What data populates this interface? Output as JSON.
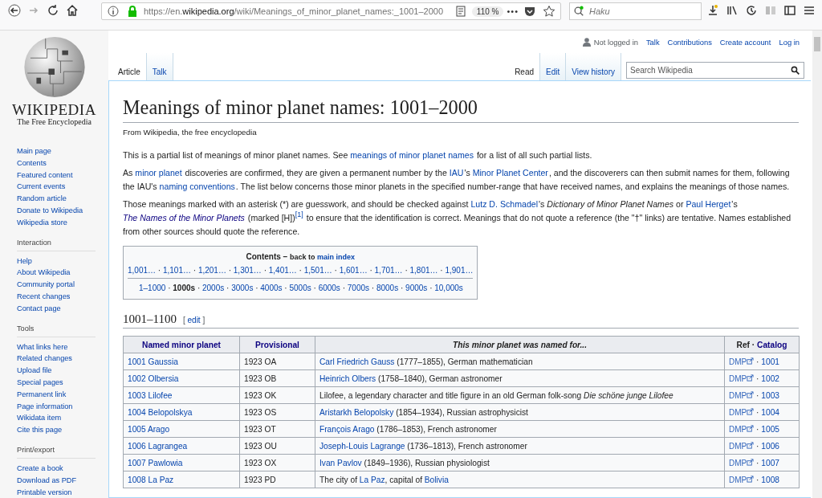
{
  "browser": {
    "forward_disabled": true,
    "url": {
      "scheme": "https://en.",
      "domain": "wikipedia.org",
      "path": "/wiki/Meanings_of_minor_planet_names:_1001–2000"
    },
    "zoom": "110 %",
    "more": "•••",
    "search": {
      "placeholder": "Haku"
    }
  },
  "logo": {
    "wordmark": "WIKIPEDIA",
    "tagline": "The Free Encyclopedia"
  },
  "sidebar": [
    {
      "items": [
        "Main page",
        "Contents",
        "Featured content",
        "Current events",
        "Random article",
        "Donate to Wikipedia",
        "Wikipedia store"
      ]
    },
    {
      "heading": "Interaction",
      "items": [
        "Help",
        "About Wikipedia",
        "Community portal",
        "Recent changes",
        "Contact page"
      ]
    },
    {
      "heading": "Tools",
      "items": [
        "What links here",
        "Related changes",
        "Upload file",
        "Special pages",
        "Permanent link",
        "Page information",
        "Wikidata item",
        "Cite this page"
      ]
    },
    {
      "heading": "Print/export",
      "items": [
        "Create a book",
        "Download as PDF",
        "Printable version"
      ]
    }
  ],
  "personal": {
    "status": "Not logged in",
    "links": [
      "Talk",
      "Contributions",
      "Create account",
      "Log in"
    ]
  },
  "tabs_left": [
    {
      "label": "Article",
      "selected": true
    },
    {
      "label": "Talk",
      "selected": false
    }
  ],
  "tabs_right": [
    {
      "label": "Read",
      "selected": true
    },
    {
      "label": "Edit",
      "selected": false
    },
    {
      "label": "View history",
      "selected": false
    }
  ],
  "wiki_search": {
    "placeholder": "Search Wikipedia"
  },
  "title": "Meanings of minor planet names: 1001–2000",
  "tagline": "From Wikipedia, the free encyclopedia",
  "paragraphs": [
    [
      {
        "kind": "text",
        "text": "This is a partial list of meanings of minor planet names. See "
      },
      {
        "kind": "link",
        "text": "meanings of minor planet names"
      },
      {
        "kind": "text",
        "text": " for a list of all such partial lists."
      }
    ],
    [
      {
        "kind": "text",
        "text": "As "
      },
      {
        "kind": "link",
        "text": "minor planet"
      },
      {
        "kind": "text",
        "text": " discoveries are confirmed, they are given a permanent number by the "
      },
      {
        "kind": "link",
        "text": "IAU"
      },
      {
        "kind": "text",
        "text": "'s "
      },
      {
        "kind": "link",
        "text": "Minor Planet Center"
      },
      {
        "kind": "text",
        "text": ", and the discoverers can then submit names for them, following the IAU's "
      },
      {
        "kind": "link",
        "text": "naming conventions"
      },
      {
        "kind": "text",
        "text": ". The list below concerns those minor planets in the specified number-range that have received names, and explains the meanings of those names."
      }
    ],
    [
      {
        "kind": "text",
        "text": "Those meanings marked with an asterisk (*) are guesswork, and should be checked against "
      },
      {
        "kind": "link",
        "text": "Lutz D. Schmadel"
      },
      {
        "kind": "text",
        "text": "'s "
      },
      {
        "kind": "italic",
        "text": "Dictionary of Minor Planet Names"
      },
      {
        "kind": "text",
        "text": " or "
      },
      {
        "kind": "link",
        "text": "Paul Herget"
      },
      {
        "kind": "text",
        "text": "'s "
      },
      {
        "kind": "italic-link",
        "text": "The Names of the Minor Planets"
      },
      {
        "kind": "text",
        "text": " (marked [H])"
      },
      {
        "kind": "sup-link",
        "text": "[1]"
      },
      {
        "kind": "text",
        "text": " to ensure that the identification is correct. Meanings that do not quote a reference (the \"†\" links) are tentative. Names established from other sources should quote the reference."
      }
    ]
  ],
  "contents": {
    "title": "Contents",
    "dash": "–",
    "back": [
      {
        "kind": "text",
        "text": "back to "
      },
      {
        "kind": "link",
        "text": "main index"
      }
    ],
    "row1": [
      {
        "label": "1,001…",
        "selected": false
      },
      {
        "label": "1,101…",
        "selected": false
      },
      {
        "label": "1,201…",
        "selected": false
      },
      {
        "label": "1,301…",
        "selected": false
      },
      {
        "label": "1,401…",
        "selected": false
      },
      {
        "label": "1,501…",
        "selected": false
      },
      {
        "label": "1,601…",
        "selected": false
      },
      {
        "label": "1,701…",
        "selected": false
      },
      {
        "label": "1,801…",
        "selected": false
      },
      {
        "label": "1,901…",
        "selected": false
      }
    ],
    "row2": [
      {
        "label": "1–1000",
        "selected": false
      },
      {
        "label": "1000s",
        "selected": true
      },
      {
        "label": "2000s",
        "selected": false
      },
      {
        "label": "3000s",
        "selected": false
      },
      {
        "label": "4000s",
        "selected": false
      },
      {
        "label": "5000s",
        "selected": false
      },
      {
        "label": "6000s",
        "selected": false
      },
      {
        "label": "7000s",
        "selected": false
      },
      {
        "label": "8000s",
        "selected": false
      },
      {
        "label": "9000s",
        "selected": false
      },
      {
        "label": "10,000s",
        "selected": false
      }
    ],
    "separator": "·"
  },
  "section": {
    "heading": "1001–1100",
    "edit_open": "[",
    "edit": "edit",
    "edit_close": "]"
  },
  "table": {
    "columns": [
      "Named minor planet",
      "Provisional",
      "This minor planet was named for...",
      "Ref",
      "Catalog"
    ],
    "separator": "·",
    "rows": [
      {
        "name": "1001 Gaussia",
        "provisional": "1923 OA",
        "meaning": [
          {
            "kind": "link",
            "text": "Carl Friedrich Gauss"
          },
          {
            "kind": "text",
            "text": " (1777–1855), German mathematician"
          }
        ],
        "ref": "DMP",
        "catalog": "1001"
      },
      {
        "name": "1002 Olbersia",
        "provisional": "1923 OB",
        "meaning": [
          {
            "kind": "link",
            "text": "Heinrich Olbers"
          },
          {
            "kind": "text",
            "text": " (1758–1840), German astronomer"
          }
        ],
        "ref": "DMP",
        "catalog": "1002"
      },
      {
        "name": "1003 Lilofee",
        "provisional": "1923 OK",
        "meaning": [
          {
            "kind": "text",
            "text": "Lilofee, a legendary character and title figure in an old German folk-song "
          },
          {
            "kind": "italic",
            "text": "Die schöne junge Lilofee"
          }
        ],
        "ref": "DMP",
        "catalog": "1003"
      },
      {
        "name": "1004 Belopolskya",
        "provisional": "1923 OS",
        "meaning": [
          {
            "kind": "link",
            "text": "Aristarkh Belopolsky"
          },
          {
            "kind": "text",
            "text": " (1854–1934), Russian astrophysicist"
          }
        ],
        "ref": "DMP",
        "catalog": "1004"
      },
      {
        "name": "1005 Arago",
        "provisional": "1923 OT",
        "meaning": [
          {
            "kind": "link",
            "text": "François Arago"
          },
          {
            "kind": "text",
            "text": " (1786–1853), French astronomer"
          }
        ],
        "ref": "DMP",
        "catalog": "1005"
      },
      {
        "name": "1006 Lagrangea",
        "provisional": "1923 OU",
        "meaning": [
          {
            "kind": "link",
            "text": "Joseph-Louis Lagrange"
          },
          {
            "kind": "text",
            "text": " (1736–1813), French astronomer"
          }
        ],
        "ref": "DMP",
        "catalog": "1006"
      },
      {
        "name": "1007 Pawlowia",
        "provisional": "1923 OX",
        "meaning": [
          {
            "kind": "link",
            "text": "Ivan Pavlov"
          },
          {
            "kind": "text",
            "text": " (1849–1936), Russian physiologist"
          }
        ],
        "ref": "DMP",
        "catalog": "1007"
      },
      {
        "name": "1008 La Paz",
        "provisional": "1923 PD",
        "meaning": [
          {
            "kind": "text",
            "text": "The city of "
          },
          {
            "kind": "link",
            "text": "La Paz"
          },
          {
            "kind": "text",
            "text": ", capital of "
          },
          {
            "kind": "link",
            "text": "Bolivia"
          }
        ],
        "ref": "DMP",
        "catalog": "1008"
      }
    ]
  }
}
